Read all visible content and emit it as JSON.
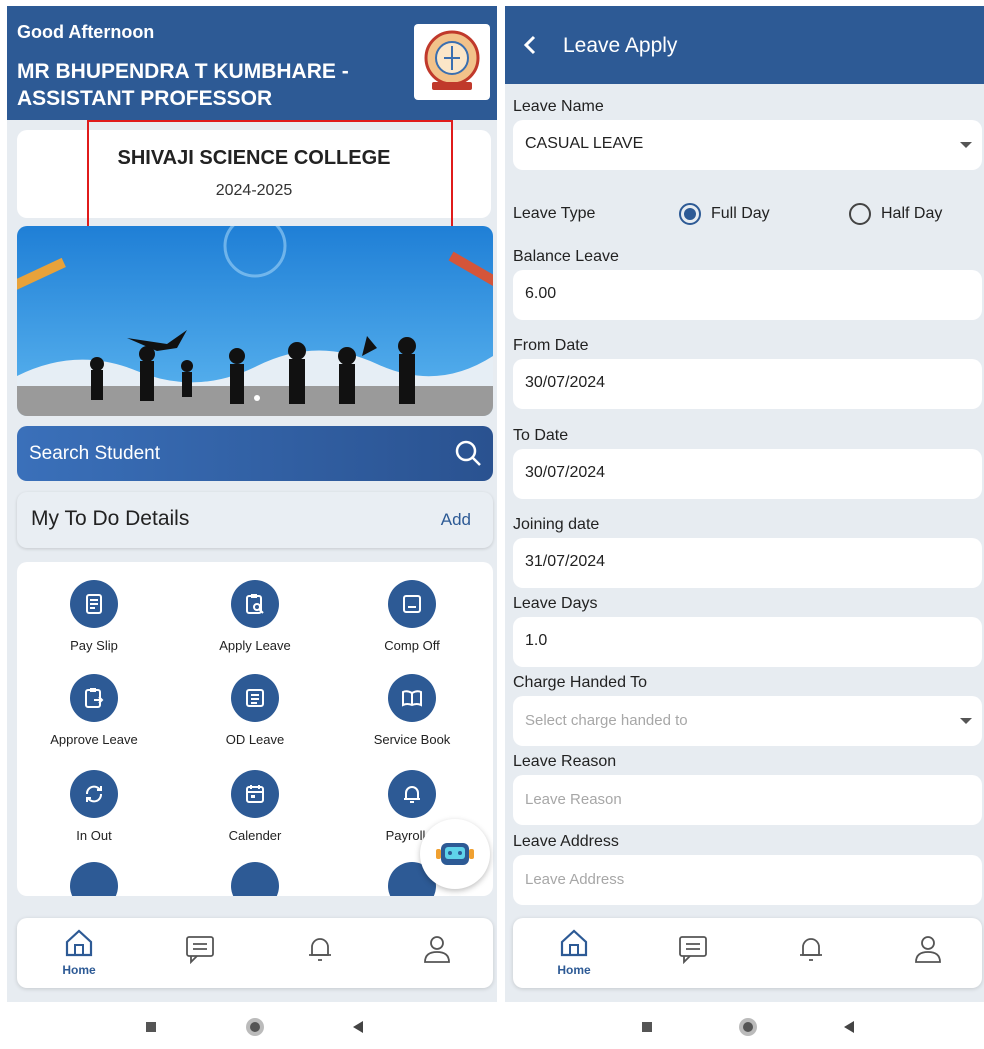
{
  "home": {
    "greeting": "Good Afternoon",
    "user_line1": "MR BHUPENDRA T KUMBHARE -",
    "user_line2": "ASSISTANT PROFESSOR",
    "college_name": "SHIVAJI SCIENCE COLLEGE",
    "academic_year": "2024-2025",
    "search_placeholder": "Search Student",
    "todo_title": "My To Do Details",
    "todo_add": "Add",
    "tiles": [
      {
        "label": "Pay Slip",
        "icon": "payslip-icon"
      },
      {
        "label": "Apply Leave",
        "icon": "apply-leave-icon"
      },
      {
        "label": "Comp Off",
        "icon": "comp-off-icon"
      },
      {
        "label": "Approve Leave",
        "icon": "approve-leave-icon"
      },
      {
        "label": "OD Leave",
        "icon": "od-leave-icon"
      },
      {
        "label": "Service Book",
        "icon": "book-icon"
      },
      {
        "label": "In Out",
        "icon": "sync-icon"
      },
      {
        "label": "Calender",
        "icon": "calendar-icon"
      },
      {
        "label": "Payroll N",
        "icon": "bell-icon"
      }
    ]
  },
  "nav": {
    "home_label": "Home"
  },
  "leave_form": {
    "title": "Leave Apply",
    "leave_name_label": "Leave Name",
    "leave_name_value": "CASUAL LEAVE",
    "leave_type_label": "Leave Type",
    "full_day_label": "Full Day",
    "half_day_label": "Half Day",
    "selected_type": "Full Day",
    "balance_label": "Balance Leave",
    "balance_value": "6.00",
    "from_label": "From Date",
    "from_value": "30/07/2024",
    "to_label": "To Date",
    "to_value": "30/07/2024",
    "joining_label": "Joining date",
    "joining_value": "31/07/2024",
    "days_label": "Leave Days",
    "days_value": "1.0",
    "charge_label": "Charge Handed To",
    "charge_placeholder": "Select charge handed to",
    "reason_label": "Leave Reason",
    "reason_placeholder": "Leave Reason",
    "address_label": "Leave Address",
    "address_placeholder": "Leave Address"
  },
  "colors": {
    "primary": "#2d5a95",
    "highlight_box": "#e01b1b",
    "background": "#e7ecf1"
  }
}
